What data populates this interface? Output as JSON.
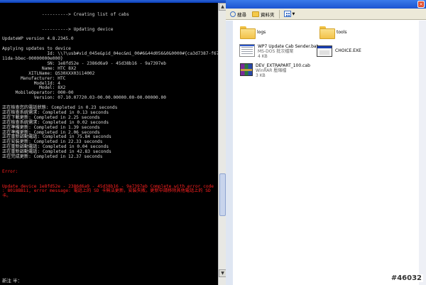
{
  "console": {
    "lines": [
      "               ----------> Creating list of cabs",
      "",
      "",
      "               ----------> Updating device",
      "",
      "UpdateWP version 4.8.2345.0",
      "",
      "Applying updates to device",
      "                 Id: \\\\?\\usb#vid_045e&pid_04ec&mi_00#6&44d056&0&0000#{ca3d7387-f67b-",
      "11da-bbec-00000000e000}",
      "                 SN: 1e8fd52e - 2386d6a9 - 45d38b16 - 9a7397eb",
      "               Name: HTC 8X2",
      "          XITLName: QS30XXX03i14002",
      "       Manufacturer: HTC",
      "            ModelId: 4",
      "              Model: 8X2",
      "     MobileOperator: 000-00",
      "            Version: 07.10.07720.03-00.00.00000.00-00.00000.00",
      "",
      "正在檢查您的電話狀態: Completed in 0.23 seconds",
      "正在檢查系統需求: Completed in 0.13 seconds",
      "正在下載更新: Completed in 2.25 seconds",
      "正在檢查系統需求: Completed in 0.02 seconds",
      "正在準備更新: Completed in 1.39 seconds",
      "正在準備更新: Completed in 2.06 seconds",
      "正在重新啟動電話: Completed in 75.84 seconds",
      "正在安裝更新: Completed in 22.33 seconds",
      "正在重新啟動電話: Completed in 0.04 seconds",
      "正在重新啟動電話: Completed in 42.83 seconds",
      "正在完成更新: Completed in 12.37 seconds"
    ],
    "error_label": "Error:",
    "error_text": "Update device 1e8fd52e - 2386d6a9 - 45d38b16 - 9a7397eb Complete with error code : 8018BB11, error message: 電話上的 SD 卡無法更新，安裝失敗。更新中請移除其他電話上的 SD 卡。",
    "status_text": "新注 半："
  },
  "explorer": {
    "toolbar": {
      "search_label": "搜尋",
      "folders_label": "資料夾"
    },
    "files": [
      {
        "name": "logs",
        "icon": "folder-icon"
      },
      {
        "name": "tools",
        "icon": "folder-icon"
      },
      {
        "name": "WP7 Update Cab Sender.bat",
        "sub1": "MS-DOS 批次檔案",
        "sub2": "4 KB",
        "icon": "bat-file-icon"
      },
      {
        "name": "CHOICE.EXE",
        "icon": "exe-file-icon"
      },
      {
        "name": "DEV_EXTRAPART_100.cab",
        "sub1": "WinRAR 壓縮檔",
        "sub2": "3 KB",
        "icon": "rar-archive-icon"
      }
    ]
  },
  "badge": "#46032",
  "colors": {
    "console_bg": "#000000",
    "console_text": "#d8d8d8",
    "error_text": "#ff2020",
    "titlebar_blue": "#1b54d0",
    "toolbar_bg": "#ece9d8"
  }
}
